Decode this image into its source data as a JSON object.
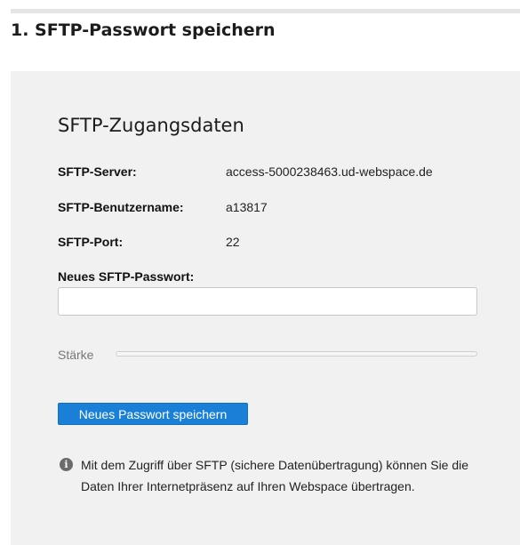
{
  "step_title": "1. SFTP-Passwort speichern",
  "card": {
    "title": "SFTP-Zugangsdaten",
    "rows": [
      {
        "label": "SFTP-Server:",
        "value": "access-5000238463.ud-webspace.de"
      },
      {
        "label": "SFTP-Benutzername:",
        "value": "a13817"
      },
      {
        "label": "SFTP-Port:",
        "value": "22"
      }
    ],
    "password": {
      "label": "Neues SFTP-Passwort:",
      "value": "",
      "placeholder": ""
    },
    "strength": {
      "label": "Stärke",
      "level": 0
    },
    "save_button": "Neues Passwort speichern",
    "info_icon": "info-circle-icon",
    "info": "Mit dem Zugriff über SFTP (sichere Datenübertragung) können Sie die Daten Ihrer Internetpräsenz auf Ihren Webspace übertragen."
  },
  "colors": {
    "primary": "#1a7fd6",
    "panel": "#f1f1f1"
  }
}
